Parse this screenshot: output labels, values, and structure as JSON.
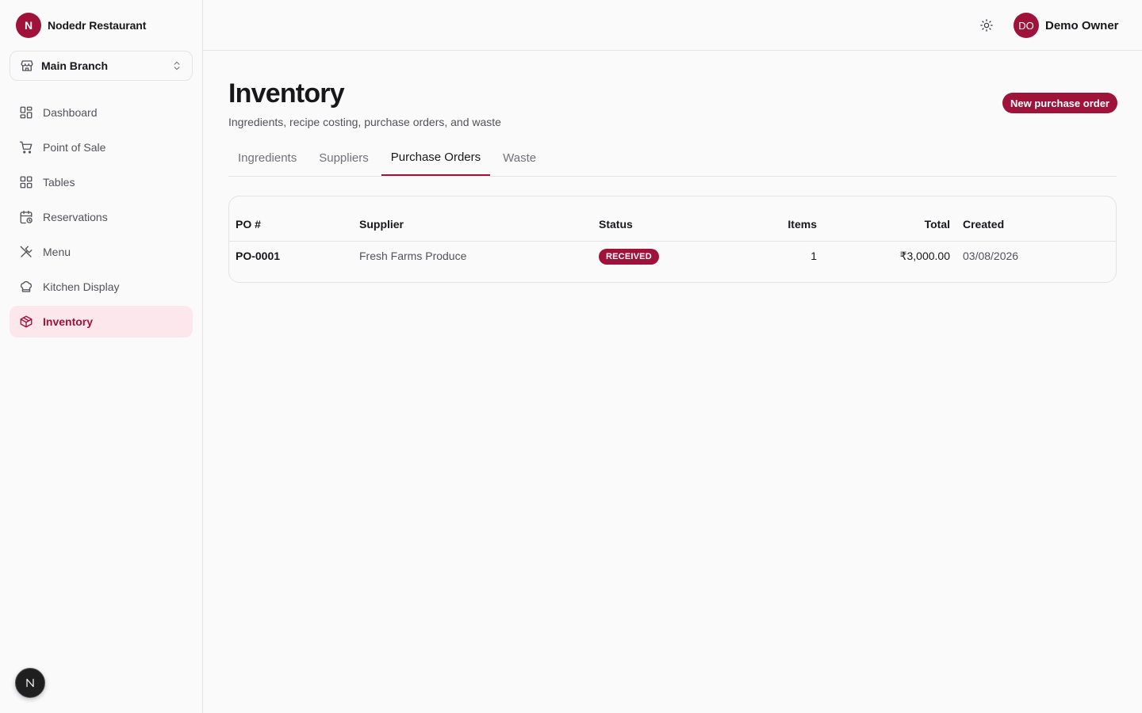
{
  "brand": {
    "logo_letter": "N",
    "name": "Nodedr Restaurant"
  },
  "branch": {
    "label": "Main Branch"
  },
  "sidebar": {
    "items": [
      {
        "label": "Dashboard",
        "icon": "dashboard-icon"
      },
      {
        "label": "Point of Sale",
        "icon": "cart-icon"
      },
      {
        "label": "Tables",
        "icon": "grid-icon"
      },
      {
        "label": "Reservations",
        "icon": "calendar-clock-icon"
      },
      {
        "label": "Menu",
        "icon": "utensils-icon"
      },
      {
        "label": "Kitchen Display",
        "icon": "chef-hat-icon"
      },
      {
        "label": "Inventory",
        "icon": "package-icon",
        "active": true
      }
    ]
  },
  "header": {
    "user_initials": "DO",
    "user_name": "Demo Owner"
  },
  "page": {
    "title": "Inventory",
    "subtitle": "Ingredients, recipe costing, purchase orders, and waste",
    "primary_action": "New purchase order"
  },
  "tabs": [
    {
      "label": "Ingredients"
    },
    {
      "label": "Suppliers"
    },
    {
      "label": "Purchase Orders",
      "active": true
    },
    {
      "label": "Waste"
    }
  ],
  "table": {
    "columns": [
      "PO #",
      "Supplier",
      "Status",
      "Items",
      "Total",
      "Created"
    ],
    "rows": [
      {
        "po": "PO-0001",
        "supplier": "Fresh Farms Produce",
        "status": "RECEIVED",
        "items": "1",
        "total": "₹3,000.00",
        "created": "03/08/2026"
      }
    ]
  },
  "colors": {
    "accent": "#9f1239",
    "accent_soft": "#fce7ec",
    "border": "#e4e4e7"
  }
}
